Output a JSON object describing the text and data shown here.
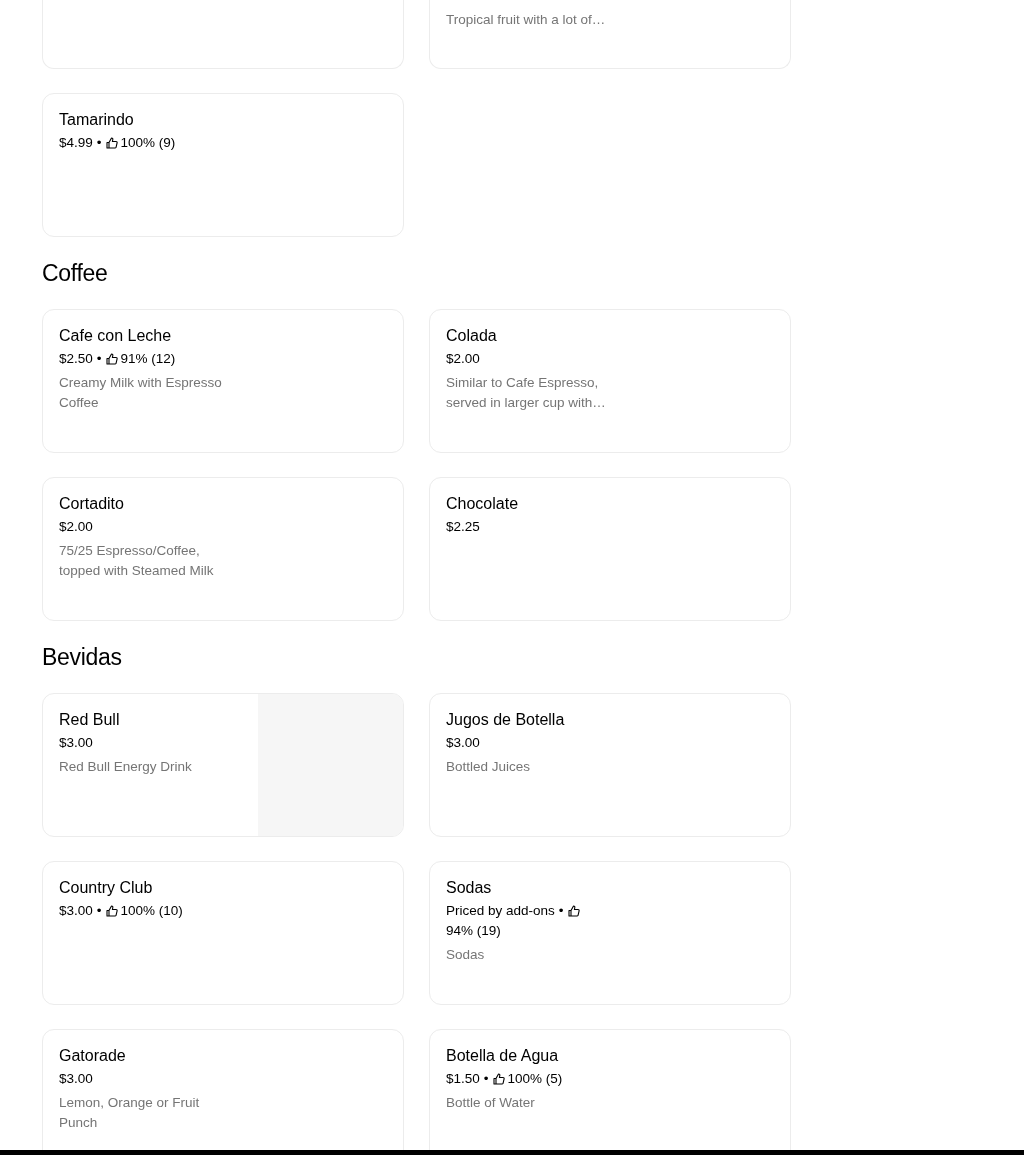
{
  "sections": [
    {
      "items": [
        {
          "kind": "cut"
        },
        {
          "kind": "cut",
          "description": "Tropical fruit with a lot of…"
        },
        {
          "kind": "full",
          "name": "Tamarindo",
          "price": "$4.99",
          "separator": "•",
          "rating": "100% (9)"
        }
      ]
    },
    {
      "title": "Coffee",
      "items": [
        {
          "kind": "full",
          "name": "Cafe con Leche",
          "price": "$2.50",
          "separator": "•",
          "rating": "91% (12)",
          "description": "Creamy Milk with Espresso Coffee"
        },
        {
          "kind": "full",
          "name": "Colada",
          "price": "$2.00",
          "description": "Similar to Cafe Espresso, served in larger cup with…"
        },
        {
          "kind": "full",
          "name": "Cortadito",
          "price": "$2.00",
          "description": "75/25 Espresso/Coffee, topped with Steamed Milk"
        },
        {
          "kind": "full",
          "name": "Chocolate",
          "price": "$2.25"
        }
      ]
    },
    {
      "title": "Bevidas",
      "items": [
        {
          "kind": "full",
          "name": "Red Bull",
          "price": "$3.00",
          "description": "Red Bull Energy Drink",
          "has_image": true
        },
        {
          "kind": "full",
          "name": "Jugos de Botella",
          "price": "$3.00",
          "description": "Bottled Juices"
        },
        {
          "kind": "full",
          "name": "Country Club",
          "price": "$3.00",
          "separator": "•",
          "rating": "100% (10)"
        },
        {
          "kind": "full",
          "name": "Sodas",
          "price": "Priced by add-ons",
          "separator": "•",
          "rating": "94% (19)",
          "description": "Sodas"
        },
        {
          "kind": "full",
          "name": "Gatorade",
          "price": "$3.00",
          "description": "Lemon, Orange or Fruit Punch"
        },
        {
          "kind": "full",
          "name": "Botella de Agua",
          "price": "$1.50",
          "separator": "•",
          "rating": "100% (5)",
          "description": "Bottle of Water"
        }
      ]
    }
  ]
}
